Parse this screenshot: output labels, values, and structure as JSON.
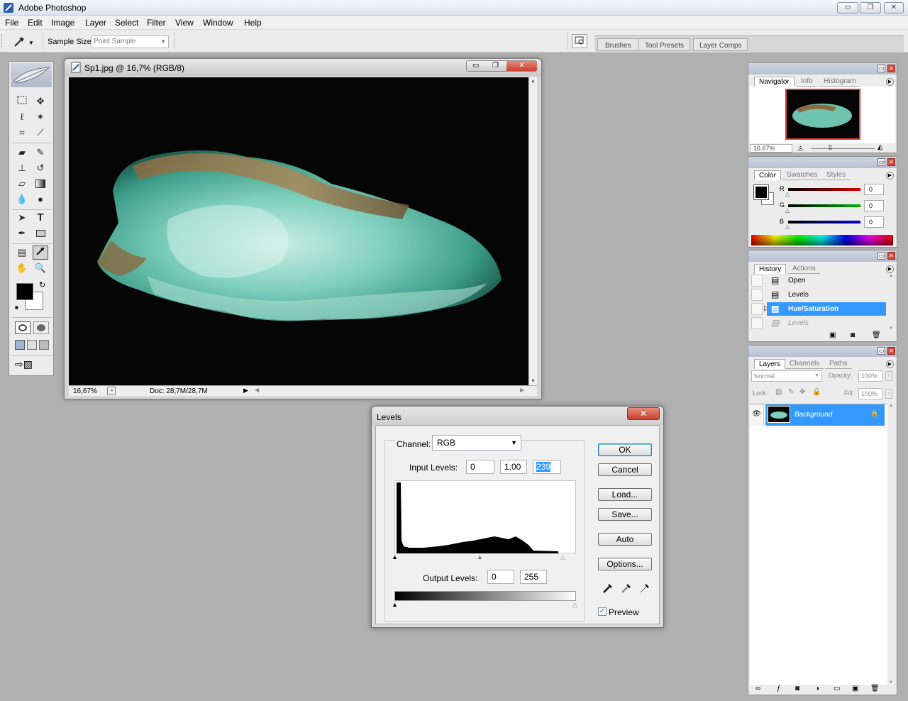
{
  "app": {
    "title": "Adobe Photoshop",
    "window_controls": {
      "minimize": "▭",
      "maximize": "❐",
      "close": "✕"
    }
  },
  "menu": [
    "File",
    "Edit",
    "Image",
    "Layer",
    "Select",
    "Filter",
    "View",
    "Window",
    "Help"
  ],
  "options_bar": {
    "sample_size_label": "Sample Size:",
    "sample_size_value": "Point Sample",
    "palette_tabs": [
      "Brushes",
      "Tool Presets",
      "Layer Comps"
    ]
  },
  "document": {
    "title": "Sp1.jpg @ 16,7% (RGB/8)",
    "zoom": "16,67%",
    "doc_info": "Doc: 28,7M/28,7M"
  },
  "levels_dialog": {
    "title": "Levels",
    "channel_label": "Channel:",
    "channel_value": "RGB",
    "input_levels_label": "Input Levels:",
    "input_black": "0",
    "input_gamma": "1,00",
    "input_white": "239",
    "output_levels_label": "Output Levels:",
    "output_black": "0",
    "output_white": "255",
    "buttons": {
      "ok": "OK",
      "cancel": "Cancel",
      "load": "Load...",
      "save": "Save...",
      "auto": "Auto",
      "options": "Options..."
    },
    "preview_label": "Preview",
    "preview_checked": true
  },
  "navigator_panel": {
    "tabs": [
      "Navigator",
      "Info",
      "Histogram"
    ],
    "zoom": "16.67%"
  },
  "color_panel": {
    "tabs": [
      "Color",
      "Swatches",
      "Styles"
    ],
    "channels": [
      {
        "label": "R",
        "value": "0",
        "color": "#d40000"
      },
      {
        "label": "G",
        "value": "0",
        "color": "#00b400"
      },
      {
        "label": "B",
        "value": "0",
        "color": "#0000d4"
      }
    ]
  },
  "history_panel": {
    "tabs": [
      "History",
      "Actions"
    ],
    "items": [
      {
        "label": "Open",
        "state": "normal"
      },
      {
        "label": "Levels",
        "state": "normal"
      },
      {
        "label": "Hue/Saturation",
        "state": "selected"
      },
      {
        "label": "Levels",
        "state": "disabled"
      }
    ]
  },
  "layers_panel": {
    "tabs": [
      "Layers",
      "Channels",
      "Paths"
    ],
    "blend_mode": "Normal",
    "opacity_label": "Opacity:",
    "opacity_value": "100%",
    "lock_label": "Lock:",
    "fill_label": "Fill:",
    "fill_value": "100%",
    "layers": [
      {
        "name": "Background",
        "selected": true
      }
    ]
  },
  "colors": {
    "accent": "#3399ff",
    "selection": "#3399ff"
  }
}
